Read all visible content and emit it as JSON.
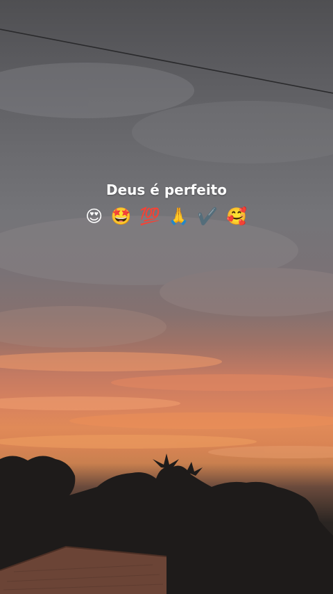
{
  "story": {
    "caption": "Deus é perfeito",
    "emojis": [
      {
        "icon": "heart-eyes-face-icon",
        "glyph": "😍"
      },
      {
        "icon": "star-struck-face-icon",
        "glyph": "🤩"
      },
      {
        "icon": "hundred-points-icon",
        "glyph": "💯"
      },
      {
        "icon": "folded-hands-icon",
        "glyph": "🙏"
      },
      {
        "icon": "check-mark-icon",
        "glyph": "✔️"
      },
      {
        "icon": "smiling-face-with-hearts-icon",
        "glyph": "🥰"
      }
    ]
  },
  "colors": {
    "sky_gray": "#6a6a6e",
    "sunset_orange": "#e08a58",
    "silhouette": "#1f1d1c",
    "roof": "#6b4436",
    "caption_text": "#ffffff"
  }
}
